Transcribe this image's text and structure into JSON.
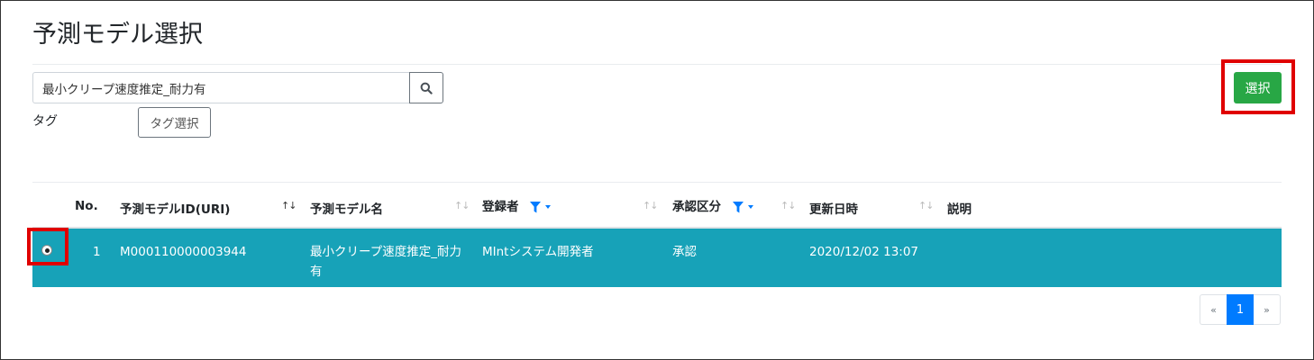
{
  "page": {
    "title": "予測モデル選択"
  },
  "search": {
    "value": "最小クリープ速度推定_耐力有",
    "placeholder": ""
  },
  "tags": {
    "label": "タグ",
    "button_label": "タグ選択"
  },
  "actions": {
    "select_label": "選択"
  },
  "table": {
    "columns": {
      "no": "No.",
      "model_id": "予測モデルID(URI)",
      "model_name": "予測モデル名",
      "registrant": "登録者",
      "approval": "承認区分",
      "updated": "更新日時",
      "description": "説明"
    },
    "sort_icons": {
      "active": "↑↓",
      "inactive": "↑↓"
    },
    "rows": [
      {
        "no": "1",
        "model_id": "M000110000003944",
        "model_name": "最小クリープ速度推定_耐力有",
        "registrant": "MIntシステム開発者",
        "approval": "承認",
        "updated": "2020/12/02 13:07",
        "description": "",
        "selected": true
      }
    ]
  },
  "pagination": {
    "prev": "«",
    "current": "1",
    "next": "»"
  },
  "colors": {
    "selected_row": "#17a2b8",
    "primary": "#007bff",
    "success": "#28a745",
    "highlight_box": "#e00000"
  }
}
